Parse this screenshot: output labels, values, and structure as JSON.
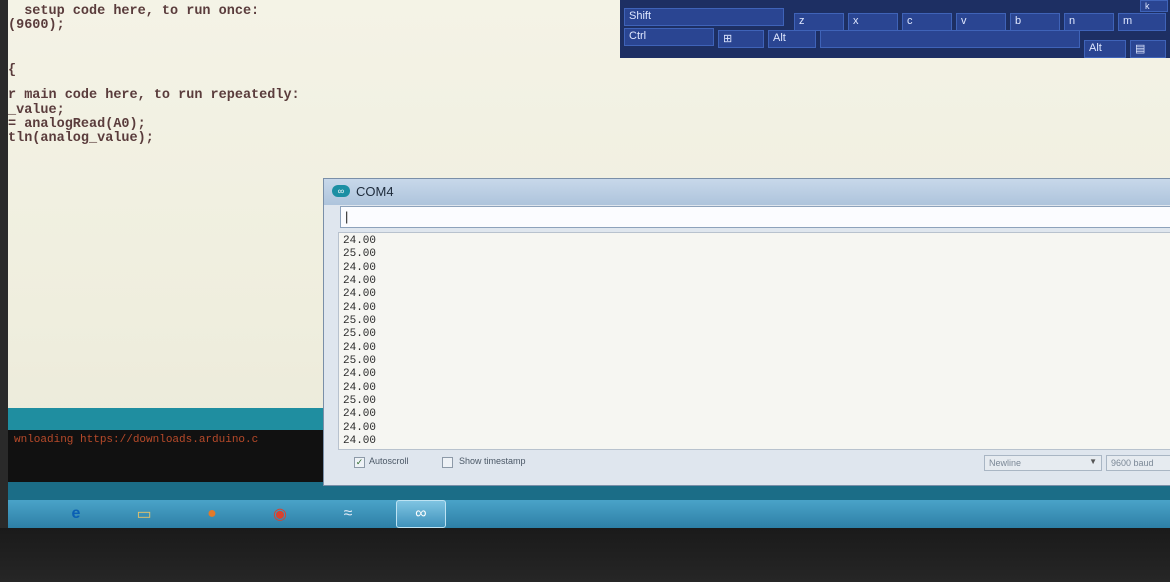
{
  "code": {
    "lines": [
      {
        "text": "  setup code here, to run once:"
      },
      {
        "text": "(9600);"
      },
      {
        "text": ""
      },
      {
        "text": "{"
      },
      {
        "text": "r main code here, to run repeatedly:"
      },
      {
        "text": "_value;"
      },
      {
        "text": "= analogRead(A0);"
      },
      {
        "text": "tln(analog_value);"
      }
    ]
  },
  "ide_console": {
    "text": "wnloading https://downloads.arduino.c"
  },
  "keyboard": {
    "keys": [
      "Shift",
      "z",
      "x",
      "c",
      "v",
      "b",
      "n",
      "m",
      "k",
      "Ctrl",
      "Alt",
      "Alt"
    ]
  },
  "serial_monitor": {
    "title": "COM4",
    "send_input_value": "|",
    "output_lines": [
      "24.00",
      "25.00",
      "24.00",
      "24.00",
      "24.00",
      "24.00",
      "25.00",
      "25.00",
      "24.00",
      "25.00",
      "24.00",
      "24.00",
      "25.00",
      "24.00",
      "24.00",
      "24.00"
    ],
    "autoscroll_label": "Autoscroll",
    "autoscroll_checked": "✓",
    "timestamp_label": "Show timestamp",
    "line_ending": "Newline",
    "baud_rate": "9600 baud"
  },
  "taskbar": {
    "icons": [
      "ie-icon",
      "folder-icon",
      "media-player-icon",
      "chrome-icon",
      "network-icon",
      "arduino-icon"
    ]
  }
}
